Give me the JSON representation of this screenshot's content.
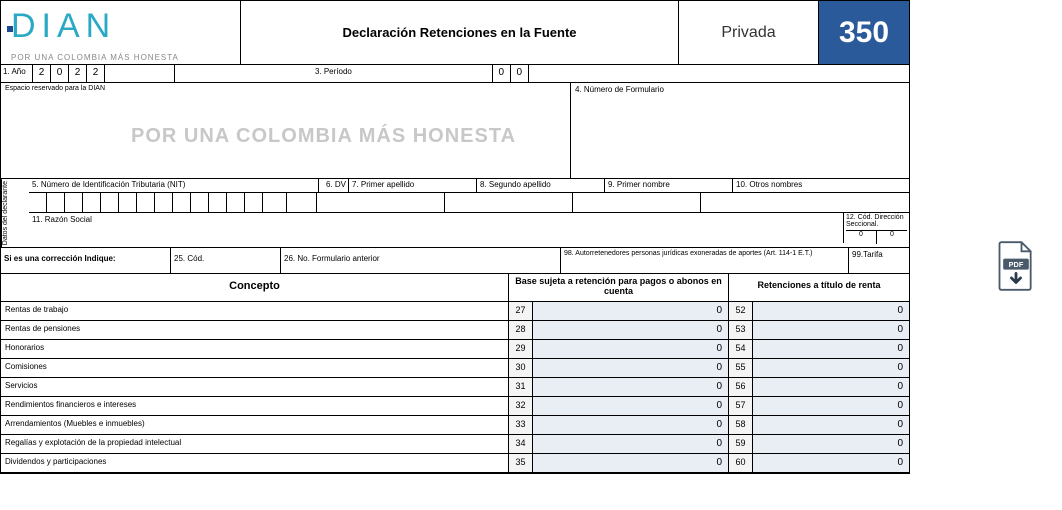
{
  "header": {
    "logo_text": "DIAN",
    "logo_sub": "POR UNA COLOMBIA MÁS HONESTA",
    "title": "Declaración Retenciones en la Fuente",
    "privada": "Privada",
    "form_code": "350"
  },
  "year_row": {
    "label": "1. Año",
    "digits": [
      "2",
      "0",
      "2",
      "2"
    ],
    "period_label": "3. Período",
    "period_digits": [
      "0",
      "0"
    ]
  },
  "watermark_area": {
    "left_small": "Espacio reservado para la DIAN",
    "watermark": "POR UNA COLOMBIA MÁS HONESTA",
    "right_label": "4. Número de Formulario"
  },
  "declarante": {
    "side_label": "Datos del declarante",
    "nit_label": "5. Número de Identificación Tributaria (NIT)",
    "dv_label": "6. DV",
    "ap1_label": "7. Primer apellido",
    "ap2_label": "8. Segundo apellido",
    "n1_label": "9. Primer nombre",
    "n2_label": "10. Otros nombres",
    "razon_label": "11. Razón Social",
    "codsec_label": "12. Cód. Dirección Seccional.",
    "codsec_digits": [
      "0",
      "0"
    ]
  },
  "correction": {
    "label": "Si es una corrección Indique:",
    "cod_label": "25. Cód.",
    "prev_label": "26. No. Formulario anterior",
    "autoret_label": "98. Autorretenedores personas jurídicas exoneradas de aportes (Art. 114-1 E.T.)",
    "tarifa_label": "99.Tarifa"
  },
  "columns": {
    "concept": "Concepto",
    "base": "Base sujeta a retención para pagos o abonos en cuenta",
    "ret": "Retenciones a título de renta"
  },
  "rows": [
    {
      "concept": "Rentas de trabajo",
      "n1": "27",
      "v1": "0",
      "n2": "52",
      "v2": "0"
    },
    {
      "concept": "Rentas de pensiones",
      "n1": "28",
      "v1": "0",
      "n2": "53",
      "v2": "0"
    },
    {
      "concept": "Honorarios",
      "n1": "29",
      "v1": "0",
      "n2": "54",
      "v2": "0"
    },
    {
      "concept": "Comisiones",
      "n1": "30",
      "v1": "0",
      "n2": "55",
      "v2": "0"
    },
    {
      "concept": "Servicios",
      "n1": "31",
      "v1": "0",
      "n2": "56",
      "v2": "0"
    },
    {
      "concept": "Rendimientos financieros e intereses",
      "n1": "32",
      "v1": "0",
      "n2": "57",
      "v2": "0"
    },
    {
      "concept": "Arrendamientos (Muebles e inmuebles)",
      "n1": "33",
      "v1": "0",
      "n2": "58",
      "v2": "0"
    },
    {
      "concept": "Regalías y explotación de la propiedad intelectual",
      "n1": "34",
      "v1": "0",
      "n2": "59",
      "v2": "0"
    },
    {
      "concept": "Dividendos y participaciones",
      "n1": "35",
      "v1": "0",
      "n2": "60",
      "v2": "0"
    }
  ],
  "pdf_button": {
    "label": "PDF"
  }
}
